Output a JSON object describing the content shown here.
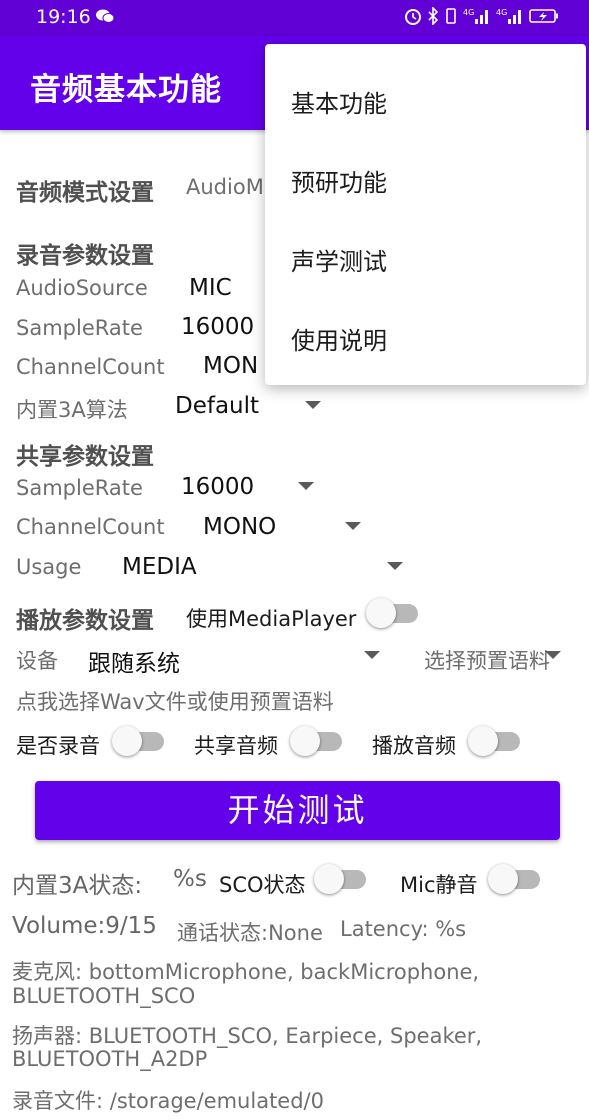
{
  "status_bar": {
    "time": "19:16",
    "icons": [
      "wechat-icon",
      "alarm-icon",
      "bluetooth-icon",
      "vibrate-icon",
      "signal-4g-icon",
      "signal-4g-icon",
      "battery-charging-icon"
    ]
  },
  "app_bar": {
    "title": "音频基本功能"
  },
  "audio_mode": {
    "heading": "音频模式设置",
    "value": "AudioM"
  },
  "record": {
    "heading": "录音参数设置",
    "source_label": "AudioSource",
    "source_value": "MIC",
    "rate_label": "SampleRate",
    "rate_value": "16000",
    "channel_label": "ChannelCount",
    "channel_value": "MON",
    "algo_label": "内置3A算法",
    "algo_value": "Default"
  },
  "share": {
    "heading": "共享参数设置",
    "rate_label": "SampleRate",
    "rate_value": "16000",
    "channel_label": "ChannelCount",
    "channel_value": "MONO",
    "usage_label": "Usage",
    "usage_value": "MEDIA"
  },
  "playback": {
    "heading": "播放参数设置",
    "mediaplayer_label": "使用MediaPlayer",
    "device_label": "设备",
    "device_value": "跟随系统",
    "preset_value": "选择预置语料",
    "pick_wav": "点我选择Wav文件或使用预置语料"
  },
  "toggles": {
    "record": "是否录音",
    "share": "共享音频",
    "play": "播放音频"
  },
  "start_button": "开始测试",
  "status": {
    "aec_label": "内置3A状态:",
    "aec_value": "%s",
    "sco_label": "SCO状态",
    "mic_mute_label": "Mic静音",
    "volume": "Volume:9/15",
    "call_state": "通话状态:None",
    "latency": "Latency:  %s",
    "mic_line1": "麦克风:  bottomMicrophone, backMicrophone,",
    "mic_line2": "BLUETOOTH_SCO",
    "spk_line1": "扬声器:  BLUETOOTH_SCO, Earpiece, Speaker,",
    "spk_line2": "BLUETOOTH_A2DP",
    "record_file": "录音文件:  /storage/emulated/0"
  },
  "menu": {
    "items": [
      "基本功能",
      "预研功能",
      "声学测试",
      "使用说明"
    ]
  }
}
